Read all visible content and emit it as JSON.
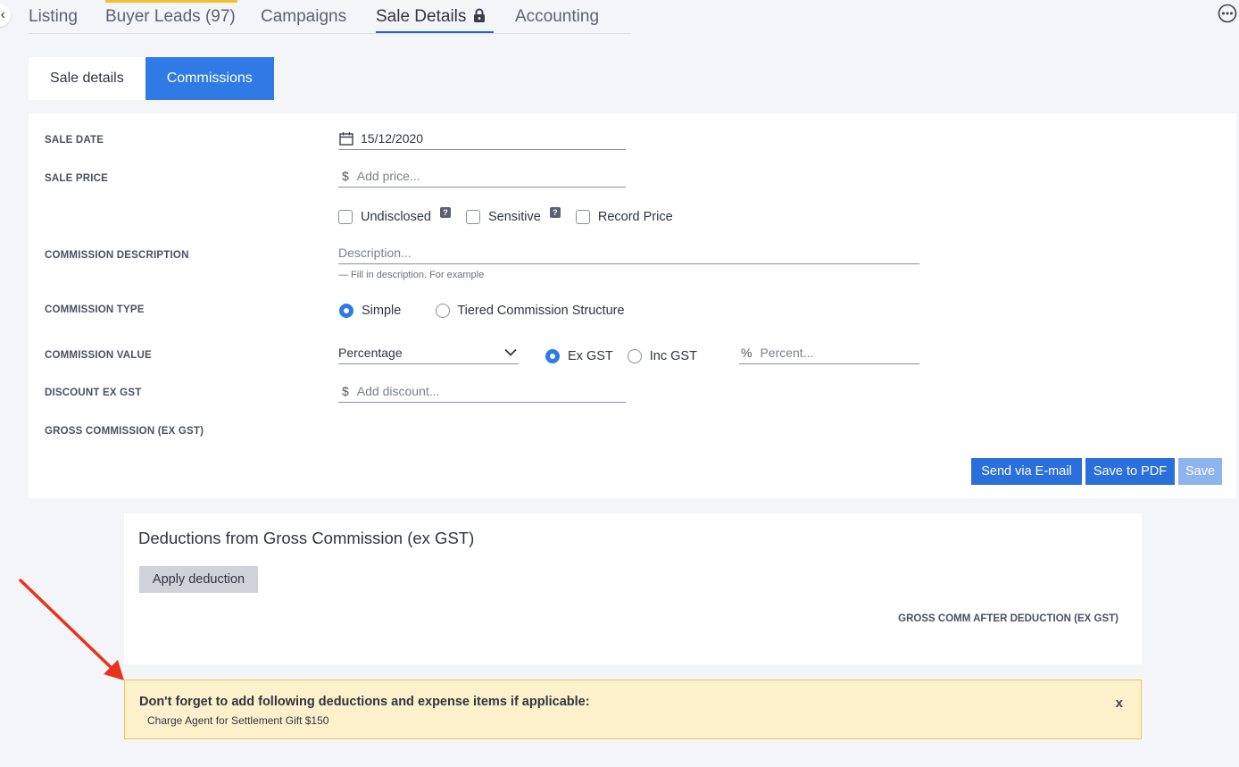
{
  "top_tabs": {
    "listing": "Listing",
    "buyer_leads": "Buyer Leads (97)",
    "campaigns": "Campaigns",
    "sale_details": "Sale Details",
    "accounting": "Accounting"
  },
  "sub_tabs": {
    "sale_details": "Sale details",
    "commissions": "Commissions"
  },
  "form": {
    "sale_date_label": "SALE DATE",
    "sale_date_value": "15/12/2020",
    "sale_price_label": "SALE PRICE",
    "sale_price_prefix": "$",
    "sale_price_placeholder": "Add price...",
    "undisclosed": "Undisclosed",
    "sensitive": "Sensitive",
    "record_price": "Record Price",
    "commission_description_label": "COMMISSION DESCRIPTION",
    "description_placeholder": "Description...",
    "description_hint": "— Fill in description. For example",
    "commission_type_label": "COMMISSION TYPE",
    "type_simple": "Simple",
    "type_tiered": "Tiered Commission Structure",
    "commission_value_label": "COMMISSION VALUE",
    "value_type_selected": "Percentage",
    "ex_gst": "Ex GST",
    "inc_gst": "Inc GST",
    "percent_prefix": "%",
    "percent_placeholder": "Percent...",
    "discount_label": "DISCOUNT EX GST",
    "discount_prefix": "$",
    "discount_placeholder": "Add discount...",
    "gross_commission_label": "GROSS COMMISSION (EX GST)"
  },
  "actions": {
    "send_email": "Send via E-mail",
    "save_pdf": "Save to PDF",
    "save": "Save"
  },
  "deductions": {
    "title": "Deductions from Gross Commission (ex GST)",
    "apply_button": "Apply deduction",
    "gross_after_label": "GROSS COMM AFTER DEDUCTION (EX GST)"
  },
  "alert": {
    "heading": "Don't forget to add following deductions and expense items if applicable:",
    "item": "Charge Agent for Settlement Gift $150",
    "close": "x"
  },
  "colors": {
    "accent": "#2f7ae5",
    "alert_bg": "#fdf1cc",
    "annotation_arrow": "#e8321c"
  }
}
